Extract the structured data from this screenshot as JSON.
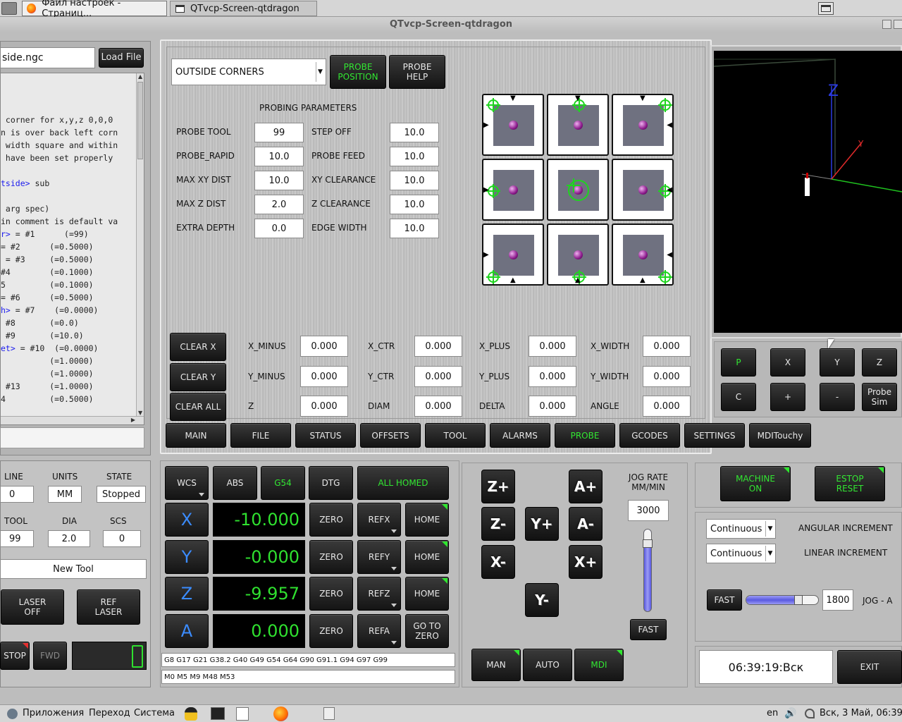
{
  "taskbar_top": {
    "tabs": [
      {
        "label": "Файл настроек - Страниц..."
      },
      {
        "label": "QTvcp-Screen-qtdragon"
      }
    ]
  },
  "window": {
    "title": "QTvcp-Screen-qtdragon"
  },
  "file_panel": {
    "filename": "side.ngc",
    "load_button": "Load File",
    "code_lines": [
      {
        "pre": "",
        "kw": "",
        "post": ""
      },
      {
        "pre": "",
        "kw": "",
        "post": ""
      },
      {
        "pre": "",
        "kw": "",
        "post": ""
      },
      {
        "pre": " corner for x,y,z 0,0,0",
        "kw": "",
        "post": ""
      },
      {
        "pre": "n is over back left corn",
        "kw": "",
        "post": ""
      },
      {
        "pre": " width square and within",
        "kw": "",
        "post": ""
      },
      {
        "pre": " have been set properly",
        "kw": "",
        "post": ""
      },
      {
        "pre": "",
        "kw": "",
        "post": ""
      },
      {
        "pre": "",
        "kw": "tside>",
        "post": " sub"
      },
      {
        "pre": "",
        "kw": "",
        "post": ""
      },
      {
        "pre": " arg spec)",
        "kw": "",
        "post": ""
      },
      {
        "pre": "in comment is default va",
        "kw": "",
        "post": ""
      },
      {
        "pre": "",
        "kw": "r>",
        "post": " = #1      (=99)"
      },
      {
        "pre": "",
        "kw": "",
        "post": "= #2      (=0.5000)"
      },
      {
        "pre": "",
        "kw": "",
        "post": " = #3     (=0.5000)"
      },
      {
        "pre": "",
        "kw": "",
        "post": "#4        (=0.1000)"
      },
      {
        "pre": "",
        "kw": "",
        "post": "5         (=0.1000)"
      },
      {
        "pre": "",
        "kw": "",
        "post": "= #6      (=0.5000)"
      },
      {
        "pre": "",
        "kw": "h>",
        "post": " = #7    (=0.0000)"
      },
      {
        "pre": "",
        "kw": "",
        "post": " #8       (=0.0)"
      },
      {
        "pre": "",
        "kw": "",
        "post": " #9       (=10.0)"
      },
      {
        "pre": "",
        "kw": "et>",
        "post": " = #10  (=0.0000)"
      },
      {
        "pre": "",
        "kw": "",
        "post": "          (=1.0000)"
      },
      {
        "pre": "",
        "kw": "",
        "post": "          (=1.0000)"
      },
      {
        "pre": "",
        "kw": "",
        "post": " #13      (=1.0000)"
      },
      {
        "pre": "",
        "kw": "",
        "post": "4         (=0.5000)"
      }
    ]
  },
  "probe": {
    "mode": "OUTSIDE CORNERS",
    "probe_position": "PROBE POSITION",
    "probe_help": "PROBE HELP",
    "params_title": "PROBING PARAMETERS",
    "params": [
      {
        "label": "PROBE TOOL",
        "value": "99",
        "label2": "STEP OFF",
        "value2": "10.0"
      },
      {
        "label": "PROBE_RAPID",
        "value": "10.0",
        "label2": "PROBE FEED",
        "value2": "10.0"
      },
      {
        "label": "MAX XY DIST",
        "value": "10.0",
        "label2": "XY CLEARANCE",
        "value2": "10.0"
      },
      {
        "label": "MAX Z DIST",
        "value": "2.0",
        "label2": "Z CLEARANCE",
        "value2": "10.0"
      },
      {
        "label": "EXTRA DEPTH",
        "value": "0.0",
        "label2": "EDGE WIDTH",
        "value2": "10.0"
      }
    ],
    "results": [
      {
        "button": "CLEAR X",
        "cols": [
          [
            "X_MINUS",
            "0.000"
          ],
          [
            "X_CTR",
            "0.000"
          ],
          [
            "X_PLUS",
            "0.000"
          ],
          [
            "X_WIDTH",
            "0.000"
          ]
        ]
      },
      {
        "button": "CLEAR Y",
        "cols": [
          [
            "Y_MINUS",
            "0.000"
          ],
          [
            "Y_CTR",
            "0.000"
          ],
          [
            "Y_PLUS",
            "0.000"
          ],
          [
            "Y_WIDTH",
            "0.000"
          ]
        ]
      },
      {
        "button": "CLEAR ALL",
        "cols": [
          [
            "Z",
            "0.000"
          ],
          [
            "DIAM",
            "0.000"
          ],
          [
            "DELTA",
            "0.000"
          ],
          [
            "ANGLE",
            "0.000"
          ]
        ]
      }
    ]
  },
  "preview": {
    "z_label": "Z",
    "buttons": [
      "P",
      "X",
      "Y",
      "Z",
      "C",
      "+",
      "-",
      "Probe Sim"
    ]
  },
  "tabs": [
    "MAIN",
    "FILE",
    "STATUS",
    "OFFSETS",
    "TOOL",
    "ALARMS",
    "PROBE",
    "GCODES",
    "SETTINGS",
    "MDITouchy"
  ],
  "status": {
    "line_label": "LINE",
    "line": "0",
    "units_label": "UNITS",
    "units": "MM",
    "state_label": "STATE",
    "state": "Stopped",
    "tool_label": "TOOL",
    "tool": "99",
    "dia_label": "DIA",
    "dia": "2.0",
    "scs_label": "SCS",
    "scs": "0",
    "new_tool": "New Tool",
    "laser_off": "LASER OFF",
    "ref_laser": "REF LASER",
    "stop": "STOP",
    "fwd": "FWD"
  },
  "dro": {
    "wcs": "WCS",
    "abs": "ABS",
    "g54": "G54",
    "dtg": "DTG",
    "all_homed": "ALL HOMED",
    "axes": [
      {
        "axis": "X",
        "value": "-10.000",
        "zero": "ZERO",
        "ref": "REFX",
        "home": "HOME"
      },
      {
        "axis": "Y",
        "value": "-0.000",
        "zero": "ZERO",
        "ref": "REFY",
        "home": "HOME"
      },
      {
        "axis": "Z",
        "value": "-9.957",
        "zero": "ZERO",
        "ref": "REFZ",
        "home": "HOME"
      },
      {
        "axis": "A",
        "value": "0.000",
        "zero": "ZERO",
        "ref": "REFA",
        "home": "GO TO ZERO"
      }
    ],
    "gcodes": "G8 G17 G21 G38.2 G40 G49 G54 G64 G90 G91.1 G94 G97 G99",
    "mcodes": "M0 M5 M9 M48 M53"
  },
  "jog": {
    "buttons": [
      "Z+",
      "Z-",
      "A+",
      "A-",
      "Y+",
      "X-",
      "X+",
      "Y-"
    ],
    "rate_label": "JOG RATE MM/MIN",
    "rate": "3000",
    "fast": "FAST",
    "modes": [
      "MAN",
      "AUTO",
      "MDI"
    ]
  },
  "machine": {
    "machine_on": "MACHINE ON",
    "estop_reset": "ESTOP RESET",
    "angular_mode": "Continuous",
    "angular_label": "ANGULAR INCREMENT",
    "linear_mode": "Continuous",
    "linear_label": "LINEAR INCREMENT",
    "fast": "FAST",
    "jog_a_value": "1800",
    "jog_a_label": "JOG - A",
    "clock": "06:39:19:Вск",
    "exit": "EXIT"
  },
  "taskbar_bottom": {
    "menus": [
      "Приложения",
      "Переход",
      "Система"
    ],
    "lang": "en",
    "datetime": "Вск,  3 Май, 06:39"
  }
}
